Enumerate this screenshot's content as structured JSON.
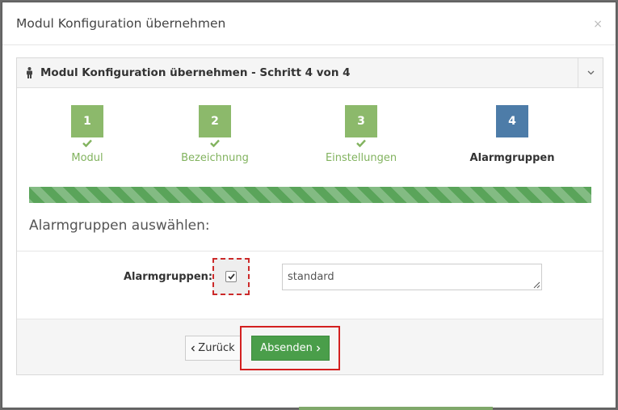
{
  "modal": {
    "title": "Modul Konfiguration übernehmen",
    "close_glyph": "×"
  },
  "box": {
    "title": "Modul Konfiguration übernehmen - Schritt 4 von 4",
    "toggle_icon": "chevron-down-icon",
    "title_icon": "person-icon"
  },
  "steps": [
    {
      "number": "1",
      "label": "Modul",
      "state": "done"
    },
    {
      "number": "2",
      "label": "Bezeichnung",
      "state": "done"
    },
    {
      "number": "3",
      "label": "Einstellungen",
      "state": "done"
    },
    {
      "number": "4",
      "label": "Alarmgruppen",
      "state": "active"
    }
  ],
  "progress": {
    "percent": 100,
    "color": "#5aa45a"
  },
  "section": {
    "title": "Alarmgruppen auswählen:"
  },
  "form": {
    "label": "Alarmgruppen:",
    "checkbox_checked": true,
    "textarea_value": "standard"
  },
  "footer": {
    "back_label": "Zurück",
    "submit_label": "Absenden"
  },
  "colors": {
    "step_done": "#8cb96b",
    "step_active": "#4d7ca8",
    "submit": "#4a9e4a",
    "highlight": "#d32020"
  }
}
